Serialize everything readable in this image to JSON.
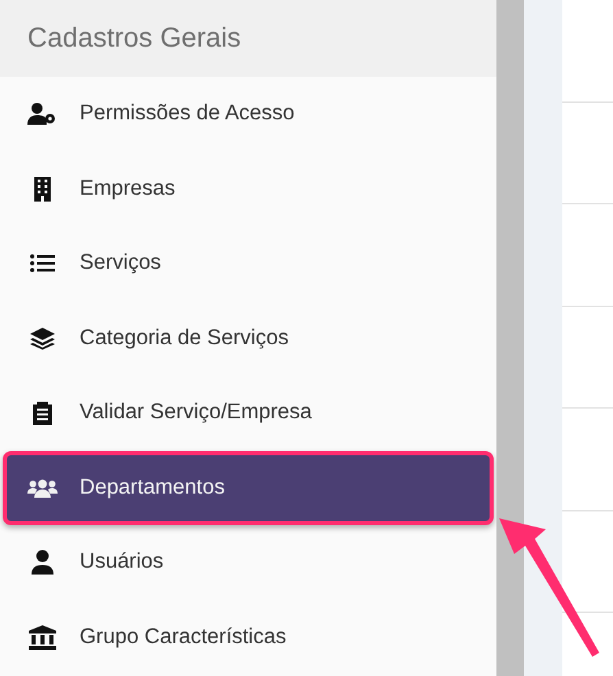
{
  "sidebar": {
    "title": "Cadastros Gerais",
    "items": [
      {
        "label": "Permissões de Acesso",
        "selected": false
      },
      {
        "label": "Empresas",
        "selected": false
      },
      {
        "label": "Serviços",
        "selected": false
      },
      {
        "label": "Categoria de Serviços",
        "selected": false
      },
      {
        "label": "Validar Serviço/Empresa",
        "selected": false
      },
      {
        "label": "Departamentos",
        "selected": true
      },
      {
        "label": "Usuários",
        "selected": false
      },
      {
        "label": "Grupo Características",
        "selected": false
      }
    ]
  },
  "annotation": {
    "arrow": true
  }
}
